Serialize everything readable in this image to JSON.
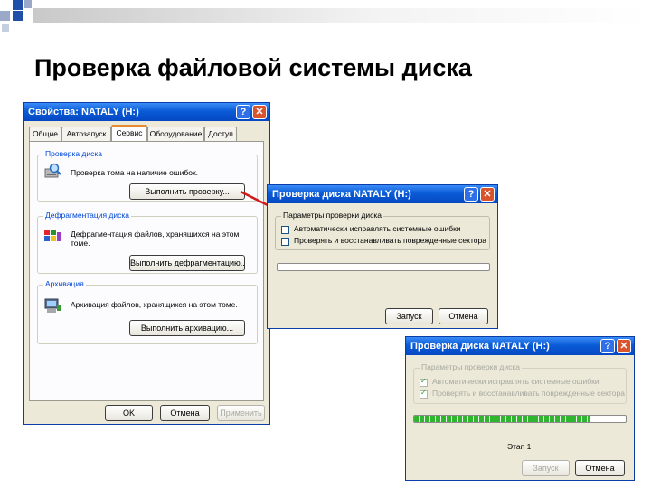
{
  "slide_title": "Проверка файловой системы диска",
  "colors": {
    "deco_square": "#1f4fa8",
    "title_bar": "#0a5bd6",
    "arrow": "#d11a1a",
    "progress_fill": "#2fb52f"
  },
  "properties_window": {
    "title": "Свойства: NATALY (H:)",
    "help_glyph": "?",
    "close_glyph": "✕",
    "tabs": [
      "Общие",
      "Автозапуск",
      "Сервис",
      "Оборудование",
      "Доступ"
    ],
    "active_tab": 2,
    "groups": {
      "check": {
        "legend": "Проверка диска",
        "text": "Проверка тома на наличие ошибок.",
        "button": "Выполнить проверку...",
        "icon": "disk-check-icon"
      },
      "defrag": {
        "legend": "Дефрагментация диска",
        "text": "Дефрагментация файлов, хранящихся на этом томе.",
        "button": "Выполнить дефрагментацию...",
        "icon": "defrag-icon"
      },
      "archive": {
        "legend": "Архивация",
        "text": "Архивация файлов, хранящихся на этом томе.",
        "button": "Выполнить архивацию...",
        "icon": "backup-icon"
      }
    },
    "buttons": {
      "ok": "OK",
      "cancel": "Отмена",
      "apply": "Применить"
    }
  },
  "check_dialog": {
    "title": "Проверка диска NATALY (H:)",
    "help_glyph": "?",
    "close_glyph": "✕",
    "group_legend": "Параметры проверки диска",
    "options": [
      {
        "label": "Автоматически исправлять системные ошибки",
        "checked": false
      },
      {
        "label": "Проверять и восстанавливать поврежденные сектора",
        "checked": false
      }
    ],
    "progress": 0,
    "buttons": {
      "start": "Запуск",
      "cancel": "Отмена"
    }
  },
  "progress_dialog": {
    "title": "Проверка диска NATALY (H:)",
    "help_glyph": "?",
    "close_glyph": "✕",
    "group_legend": "Параметры проверки диска",
    "options": [
      {
        "label": "Автоматически исправлять системные ошибки",
        "checked": true
      },
      {
        "label": "Проверять и восстанавливать поврежденные сектора",
        "checked": true
      }
    ],
    "progress": 0.83,
    "status_label": "Этап 1",
    "buttons": {
      "start": "Запуск",
      "cancel": "Отмена"
    }
  }
}
